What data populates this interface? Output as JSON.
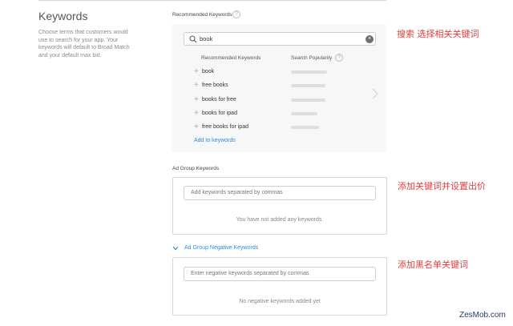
{
  "keywords_section": {
    "title": "Keywords",
    "description": "Choose terms that customers would use to search for your app. Your keywords will default to Broad Match and your default max bid."
  },
  "recommended": {
    "label": "Recommended Keywords",
    "search_value": "book",
    "col_keywords": "Recommended Keywords",
    "col_popularity": "Search Popularity",
    "items": [
      {
        "keyword": "book",
        "popularity": 0.82
      },
      {
        "keyword": "free books",
        "popularity": 0.78
      },
      {
        "keyword": "books for free",
        "popularity": 0.78
      },
      {
        "keyword": "books for ipad",
        "popularity": 0.6
      },
      {
        "keyword": "free books for ipad",
        "popularity": 0.64
      }
    ],
    "add_link": "Add to keywords"
  },
  "ad_group_keywords": {
    "label": "Ad Group Keywords",
    "placeholder": "Add keywords separated by commas",
    "empty_message": "You have not added any keywords."
  },
  "negative_keywords": {
    "label": "Ad Group Negative Keywords",
    "placeholder": "Enter negative keywords separated by commas",
    "empty_message": "No negative keywords added yet"
  },
  "annotations": {
    "search_note": "搜索 选择相关关键词",
    "add_note": "添加关键词并设置出价",
    "negative_note": "添加黑名单关键词"
  },
  "watermark": "ZesMob.com",
  "colors": {
    "accent": "#2c8be0",
    "annotation": "#e23c3c"
  }
}
